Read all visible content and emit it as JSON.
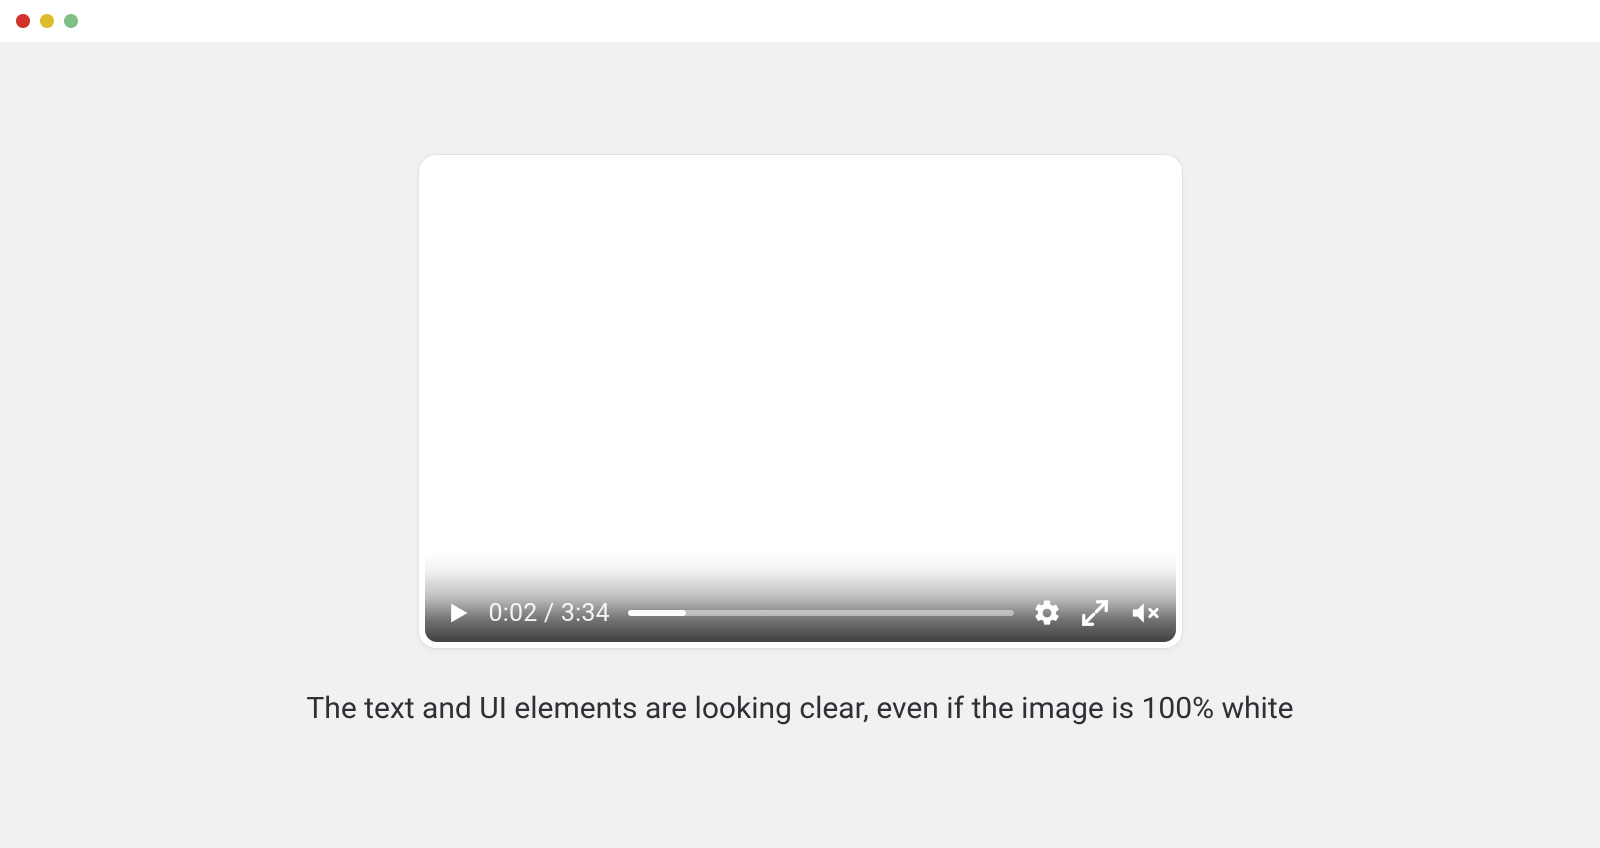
{
  "window": {
    "traffic_lights": {
      "red": "#d0332d",
      "yellow": "#debb2b",
      "green": "#7fc084"
    }
  },
  "video": {
    "current_time": "0:02",
    "duration": "3:34",
    "time_separator": " / ",
    "progress_percent": 15,
    "icons": {
      "play": "play-icon",
      "settings": "gear-icon",
      "fullscreen": "fullscreen-icon",
      "mute": "volume-muted-icon"
    }
  },
  "caption": "The text and UI elements are looking clear, even if the image is 100% white"
}
